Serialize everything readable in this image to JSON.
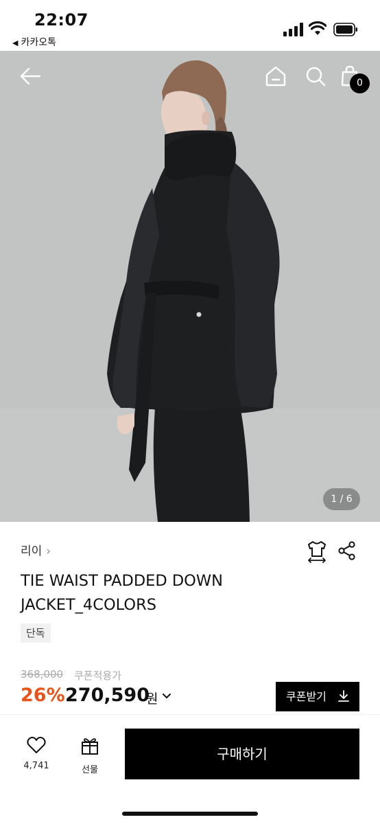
{
  "status": {
    "time": "22:07",
    "back_app": "카카오톡"
  },
  "header": {
    "cart_count": "0"
  },
  "gallery": {
    "counter": "1 / 6"
  },
  "product": {
    "brand": "리이",
    "title": "TIE WAIST PADDED DOWN JACKET_4COLORS",
    "badge": "단독",
    "original_price": "368,000",
    "coupon_note": "쿠폰적용가",
    "discount": "26%",
    "price": "270,590",
    "currency": "원",
    "coupon_button": "쿠폰받기"
  },
  "bottom_bar": {
    "like_count": "4,741",
    "gift_label": "선물",
    "buy_label": "구매하기"
  },
  "colors": {
    "discount": "#e8541a",
    "primary": "#000000"
  }
}
